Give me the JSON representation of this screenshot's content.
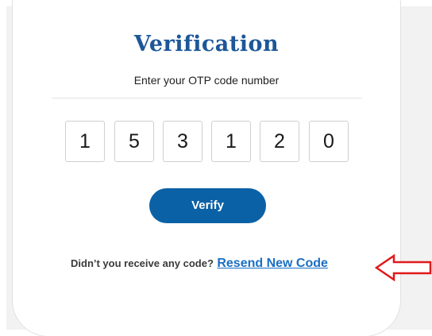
{
  "verification": {
    "title": "Verification",
    "subtitle": "Enter your OTP code number",
    "otp_digits": [
      "1",
      "5",
      "3",
      "1",
      "2",
      "0"
    ],
    "verify_label": "Verify",
    "resend_prompt": "Didn’t you receive any code?",
    "resend_link": "Resend New Code"
  },
  "annotation": {
    "arrow_icon": "red-arrow-left-icon",
    "arrow_color": "#e0191b"
  },
  "colors": {
    "title": "#1c5798",
    "button": "#0b61a6",
    "link": "#1a6fc4"
  }
}
